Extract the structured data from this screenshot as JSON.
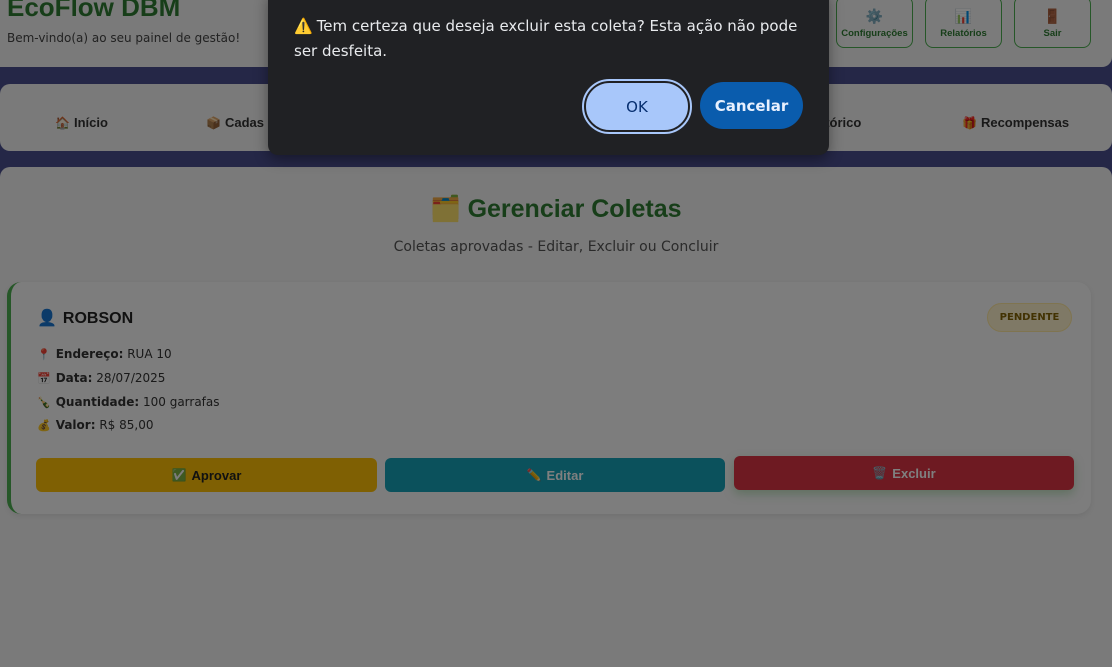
{
  "header": {
    "title": "EcoFlow DBM",
    "subtitle": "Bem-vindo(a) ao seu painel de gestão!",
    "buttons": [
      {
        "label": "Configurações",
        "icon": "gear-icon"
      },
      {
        "label": "Relatórios",
        "icon": "bar-chart-icon"
      },
      {
        "label": "Sair",
        "icon": "door-icon"
      }
    ]
  },
  "nav": {
    "items": [
      {
        "label": "Início",
        "icon": "house-icon"
      },
      {
        "label": "Cadas",
        "icon": "package-icon"
      },
      {
        "label": "stórico",
        "icon": ""
      },
      {
        "label": "Recompensas",
        "icon": "gift-icon"
      }
    ]
  },
  "page": {
    "title": "Gerenciar Coletas",
    "title_icon": "folder-icon",
    "subtitle": "Coletas aprovadas - Editar, Excluir ou Concluir"
  },
  "collection": {
    "name": "ROBSON",
    "status": "PENDENTE",
    "fields": [
      {
        "key": "Endereço:",
        "value": "RUA 10",
        "icon": "pin-icon"
      },
      {
        "key": "Data:",
        "value": "28/07/2025",
        "icon": "calendar-icon"
      },
      {
        "key": "Quantidade:",
        "value": "100 garrafas",
        "icon": "bottle-icon"
      },
      {
        "key": "Valor:",
        "value": "R$ 85,00",
        "icon": "money-bag-icon"
      }
    ],
    "actions": {
      "approve": "Aprovar",
      "edit": "Editar",
      "delete": "Excluir"
    }
  },
  "dialog": {
    "message": "Tem certeza que deseja excluir esta coleta? Esta ação não pode ser desfeita.",
    "ok_label": "OK",
    "cancel_label": "Cancelar"
  },
  "colors": {
    "brand_green": "#2e7d32",
    "nav_band": "#4a4f8f",
    "approve": "#ffc107",
    "edit": "#17a2b8",
    "delete": "#dc3545",
    "dialog_bg": "#202124",
    "ok_bg": "#a8c7fa"
  }
}
